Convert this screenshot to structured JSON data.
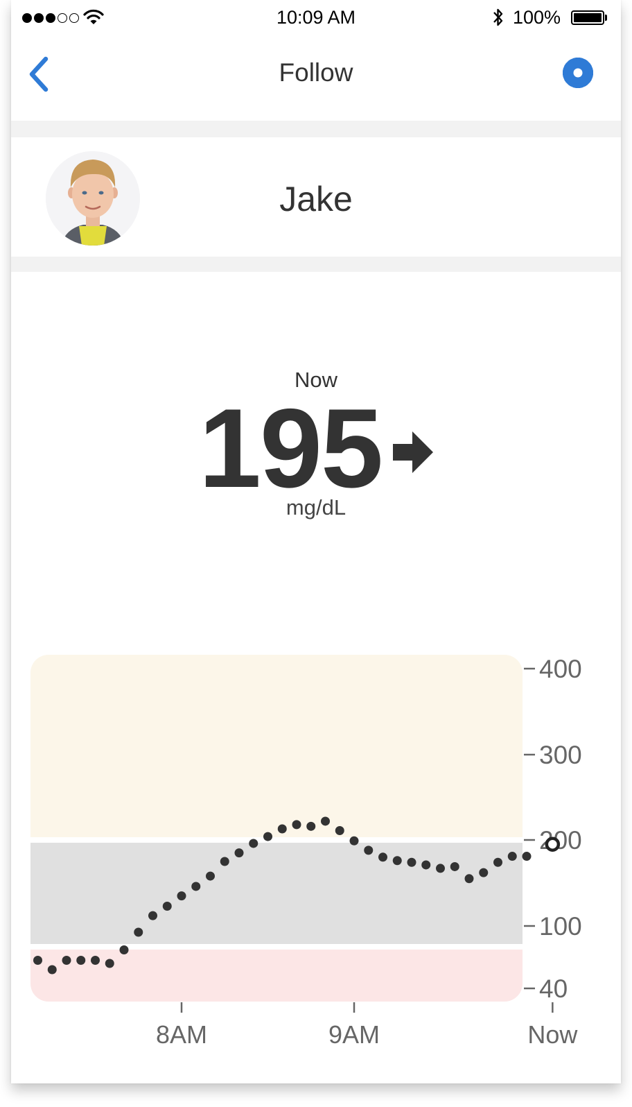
{
  "status_bar": {
    "time": "10:09 AM",
    "battery_percent": "100%",
    "signal_bars_filled": 3,
    "signal_bars_total": 5,
    "icons": [
      "wifi-icon",
      "bluetooth-icon",
      "battery-icon"
    ]
  },
  "nav": {
    "title": "Follow",
    "back_icon": "chevron-left-icon",
    "settings_icon": "gear-icon",
    "accent_color": "#2f7bd6"
  },
  "profile": {
    "name": "Jake"
  },
  "reading": {
    "label": "Now",
    "value": "195",
    "unit": "mg/dL",
    "trend_icon": "arrow-right-icon"
  },
  "chart_data": {
    "type": "scatter",
    "x_ticks": [
      "8AM",
      "9AM",
      "Now"
    ],
    "y_ticks": [
      400,
      300,
      200,
      100,
      40
    ],
    "ylim": [
      40,
      400
    ],
    "bands": [
      {
        "from": 200,
        "to": 400,
        "color": "#fcf6e9"
      },
      {
        "from": 80,
        "to": 200,
        "color": "#e0e0e0"
      },
      {
        "from": 40,
        "to": 80,
        "color": "#fce6e6"
      }
    ],
    "series": [
      {
        "points": [
          {
            "x": "7:10",
            "y": 67
          },
          {
            "x": "7:15",
            "y": 58
          },
          {
            "x": "7:20",
            "y": 67
          },
          {
            "x": "7:25",
            "y": 67
          },
          {
            "x": "7:30",
            "y": 67
          },
          {
            "x": "7:35",
            "y": 64
          },
          {
            "x": "7:40",
            "y": 77
          },
          {
            "x": "7:45",
            "y": 94
          },
          {
            "x": "7:50",
            "y": 112
          },
          {
            "x": "7:55",
            "y": 123
          },
          {
            "x": "8:00",
            "y": 135
          },
          {
            "x": "8:05",
            "y": 146
          },
          {
            "x": "8:10",
            "y": 158
          },
          {
            "x": "8:15",
            "y": 175
          },
          {
            "x": "8:20",
            "y": 185
          },
          {
            "x": "8:25",
            "y": 196
          },
          {
            "x": "8:30",
            "y": 204
          },
          {
            "x": "8:35",
            "y": 213
          },
          {
            "x": "8:40",
            "y": 218
          },
          {
            "x": "8:45",
            "y": 216
          },
          {
            "x": "8:50",
            "y": 222
          },
          {
            "x": "8:55",
            "y": 211
          },
          {
            "x": "9:00",
            "y": 199
          },
          {
            "x": "9:05",
            "y": 188
          },
          {
            "x": "9:10",
            "y": 180
          },
          {
            "x": "9:15",
            "y": 176
          },
          {
            "x": "9:20",
            "y": 174
          },
          {
            "x": "9:25",
            "y": 171
          },
          {
            "x": "9:30",
            "y": 167
          },
          {
            "x": "9:35",
            "y": 169
          },
          {
            "x": "9:40",
            "y": 155
          },
          {
            "x": "9:45",
            "y": 162
          },
          {
            "x": "9:50",
            "y": 174
          },
          {
            "x": "9:55",
            "y": 181
          },
          {
            "x": "10:00",
            "y": 181
          },
          {
            "x": "10:09",
            "y": 195,
            "current": true
          }
        ]
      }
    ]
  }
}
